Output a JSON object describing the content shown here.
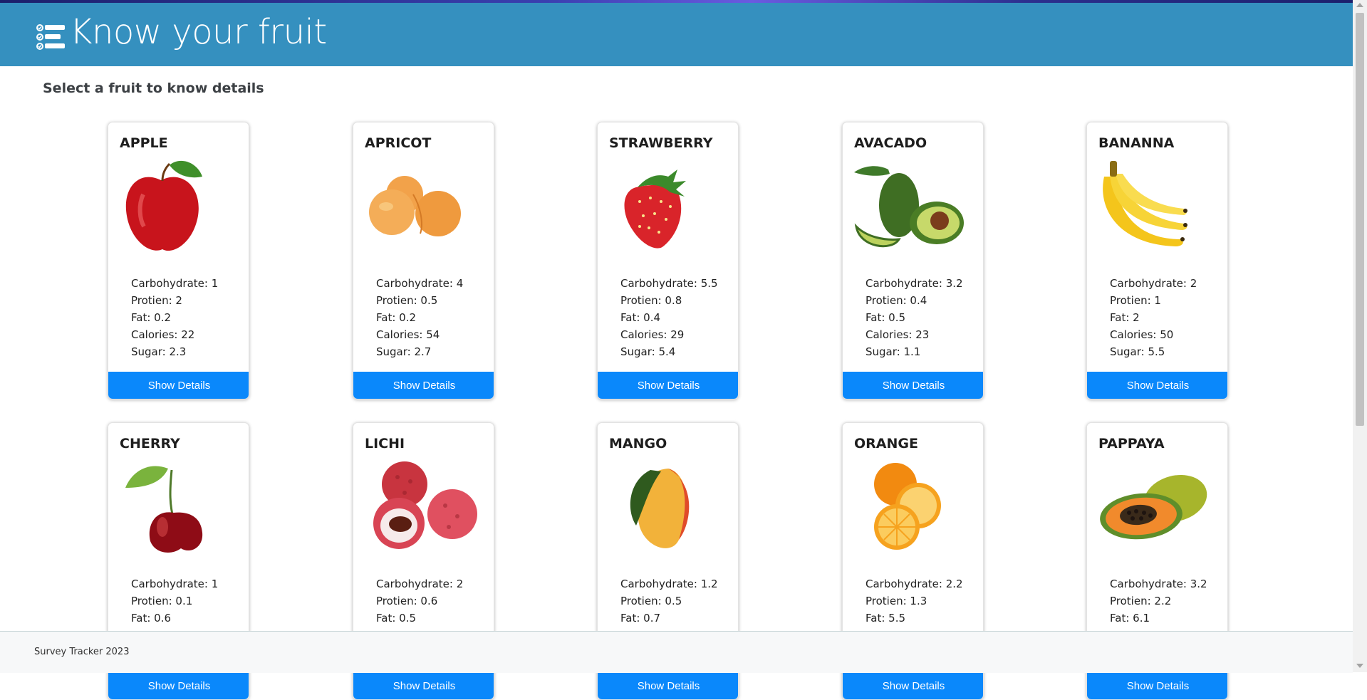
{
  "app": {
    "title": "Know your fruit",
    "subtitle": "Select a fruit to know details"
  },
  "icons": {
    "brand": "checklist-icon"
  },
  "labels": {
    "carbohydrate": "Carbohydrate:",
    "protein": "Protien:",
    "fat": "Fat:",
    "calories": "Calories:",
    "sugar": "Sugar:",
    "button": "Show Details"
  },
  "fruits": [
    {
      "name": "APPLE",
      "carbohydrate": "1",
      "protein": "2",
      "fat": "0.2",
      "calories": "22",
      "sugar": "2.3"
    },
    {
      "name": "APRICOT",
      "carbohydrate": "4",
      "protein": "0.5",
      "fat": "0.2",
      "calories": "54",
      "sugar": "2.7"
    },
    {
      "name": "STRAWBERRY",
      "carbohydrate": "5.5",
      "protein": "0.8",
      "fat": "0.4",
      "calories": "29",
      "sugar": "5.4"
    },
    {
      "name": "AVACADO",
      "carbohydrate": "3.2",
      "protein": "0.4",
      "fat": "0.5",
      "calories": "23",
      "sugar": "1.1"
    },
    {
      "name": "BANANNA",
      "carbohydrate": "2",
      "protein": "1",
      "fat": "2",
      "calories": "50",
      "sugar": "5.5"
    },
    {
      "name": "CHERRY",
      "carbohydrate": "1",
      "protein": "0.1",
      "fat": "0.6"
    },
    {
      "name": "LICHI",
      "carbohydrate": "2",
      "protein": "0.6",
      "fat": "0.5"
    },
    {
      "name": "MANGO",
      "carbohydrate": "1.2",
      "protein": "0.5",
      "fat": "0.7"
    },
    {
      "name": "ORANGE",
      "carbohydrate": "2.2",
      "protein": "1.3",
      "fat": "5.5"
    },
    {
      "name": "PAPPAYA",
      "carbohydrate": "3.2",
      "protein": "2.2",
      "fat": "6.1"
    }
  ],
  "footer": {
    "text": "Survey Tracker 2023"
  },
  "colors": {
    "header": "#3590bf",
    "button": "#0a88fb",
    "footer": "#f7f8f9"
  }
}
